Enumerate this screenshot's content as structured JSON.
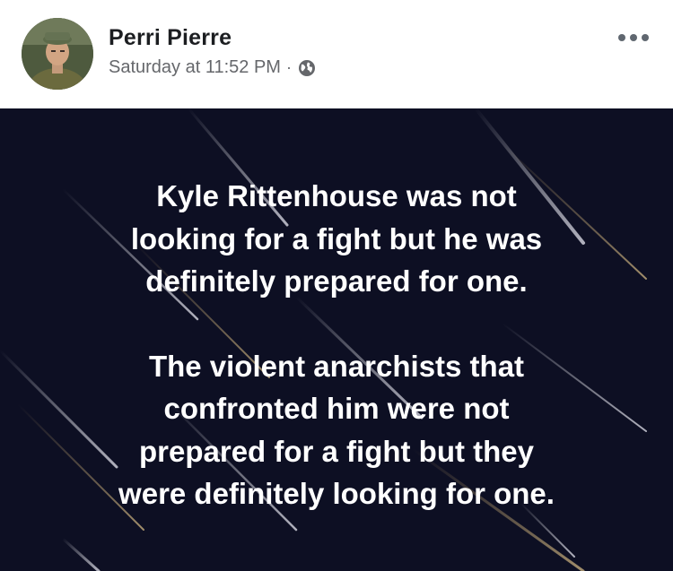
{
  "post": {
    "author": "Perri Pierre",
    "timestamp": "Saturday at 11:52 PM",
    "separator": "·",
    "privacy_icon": "globe-icon",
    "more_icon": "more-options-icon",
    "background_color": "#0d0f23",
    "text_color": "#ffffff",
    "paragraphs": [
      {
        "lines": [
          "Kyle Rittenhouse was not",
          "looking for a fight but he was",
          "definitely prepared for one."
        ]
      },
      {
        "lines": [
          "The violent anarchists that",
          "confronted him were not",
          "prepared for a fight but they",
          "were definitely looking for one."
        ]
      }
    ]
  }
}
